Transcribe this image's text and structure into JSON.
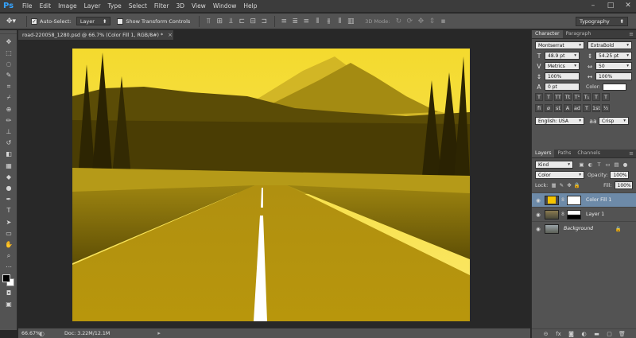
{
  "app": {
    "logo": "Ps"
  },
  "menu": [
    "File",
    "Edit",
    "Image",
    "Layer",
    "Type",
    "Select",
    "Filter",
    "3D",
    "View",
    "Window",
    "Help"
  ],
  "window_controls": {
    "minimize": "–",
    "restore": "□",
    "close": "✕"
  },
  "options_bar": {
    "auto_select_label": "Auto-Select:",
    "auto_select_value": "Layer",
    "show_transform_label": "Show Transform Controls",
    "mode_3d_label": "3D Mode:",
    "workspace": "Typography"
  },
  "document": {
    "tab_title": "road-220058_1280.psd @ 66.7% (Color Fill 1, RGB/8#) *",
    "close_label": "×"
  },
  "status": {
    "zoom": "66.67%",
    "doc_size": "Doc: 3.22M/12.1M",
    "arrow": "▸"
  },
  "character_panel": {
    "tabs": [
      "Character",
      "Paragraph"
    ],
    "font_family": "Montserrat",
    "font_style": "ExtraBold",
    "font_size": "48.9 pt",
    "leading": "54.25 pt",
    "kerning": "Metrics",
    "tracking": "50",
    "vertical_scale": "100%",
    "horizontal_scale": "100%",
    "baseline_shift": "0 pt",
    "color_label": "Color:",
    "color": "#ffffff",
    "language": "English: USA",
    "antialias": "Crisp",
    "type_buttons": [
      "T",
      "T",
      "TT",
      "Tt",
      "T¹",
      "T₁",
      "T",
      "T"
    ],
    "opentype_buttons": [
      "ﬁ",
      "ø",
      "st",
      "A",
      "ad",
      "T",
      "1st",
      "½"
    ],
    "aa_label": "aa"
  },
  "layers_panel": {
    "tabs": [
      "Layers",
      "Paths",
      "Channels"
    ],
    "filter_label": "Kind",
    "blend_mode": "Color",
    "opacity_label": "Opacity:",
    "opacity": "100%",
    "lock_label": "Lock:",
    "fill_label": "Fill:",
    "fill": "100%",
    "layers": [
      {
        "name": "Color Fill 1",
        "selected": true,
        "fill_color": "#f5c400"
      },
      {
        "name": "Layer 1",
        "selected": false
      },
      {
        "name": "Background",
        "selected": false,
        "locked": true
      }
    ]
  },
  "colors": {
    "tint": "#e6c200",
    "foreground": "#000000",
    "background": "#ffffff",
    "accent_selected": "#6d8aa8"
  }
}
